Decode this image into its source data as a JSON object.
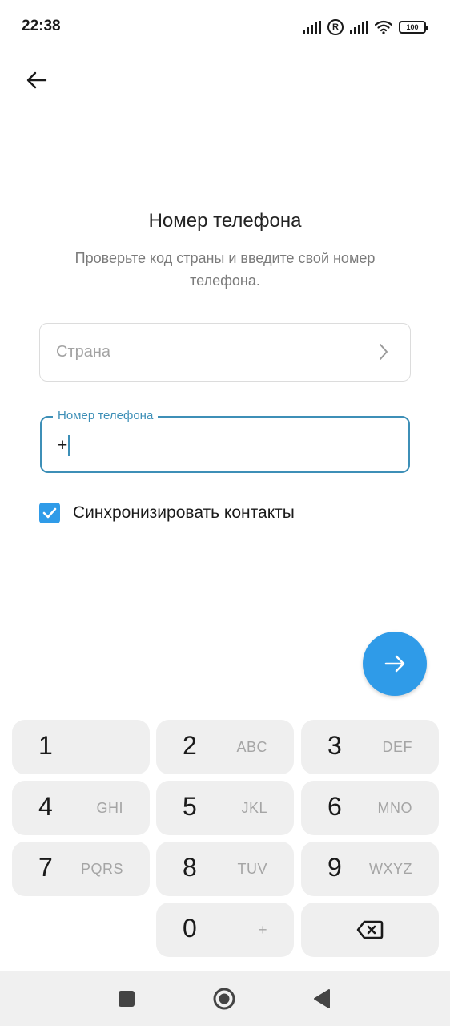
{
  "status_bar": {
    "time": "22:38",
    "battery": "100",
    "icons": [
      "cellular-signal-icon",
      "registered-icon",
      "cellular-signal-icon",
      "wifi-icon",
      "battery-icon"
    ]
  },
  "header": {
    "back_icon": "arrow-left-icon"
  },
  "title": "Номер телефона",
  "subtitle": "Проверьте код страны и введите свой номер телефона.",
  "country_field": {
    "placeholder": "Страна",
    "icon": "chevron-right-icon"
  },
  "phone_field": {
    "label": "Номер телефона",
    "code": "+",
    "number": ""
  },
  "sync_contacts": {
    "label": "Синхронизировать контакты",
    "checked": true
  },
  "next_button": {
    "icon": "arrow-right-icon"
  },
  "keypad": {
    "keys": [
      {
        "digit": "1",
        "letters": ""
      },
      {
        "digit": "2",
        "letters": "ABC"
      },
      {
        "digit": "3",
        "letters": "DEF"
      },
      {
        "digit": "4",
        "letters": "GHI"
      },
      {
        "digit": "5",
        "letters": "JKL"
      },
      {
        "digit": "6",
        "letters": "MNO"
      },
      {
        "digit": "7",
        "letters": "PQRS"
      },
      {
        "digit": "8",
        "letters": "TUV"
      },
      {
        "digit": "9",
        "letters": "WXYZ"
      },
      {
        "digit": "0",
        "letters": "+"
      }
    ],
    "backspace_icon": "backspace-icon"
  },
  "nav_bar": {
    "icons": [
      "recents-square-icon",
      "home-circle-icon",
      "back-triangle-icon"
    ]
  },
  "colors": {
    "accent": "#2f9be8",
    "field_focus": "#3d8fb7",
    "key_bg": "#efefef",
    "nav_bg": "#f0f0f0"
  }
}
